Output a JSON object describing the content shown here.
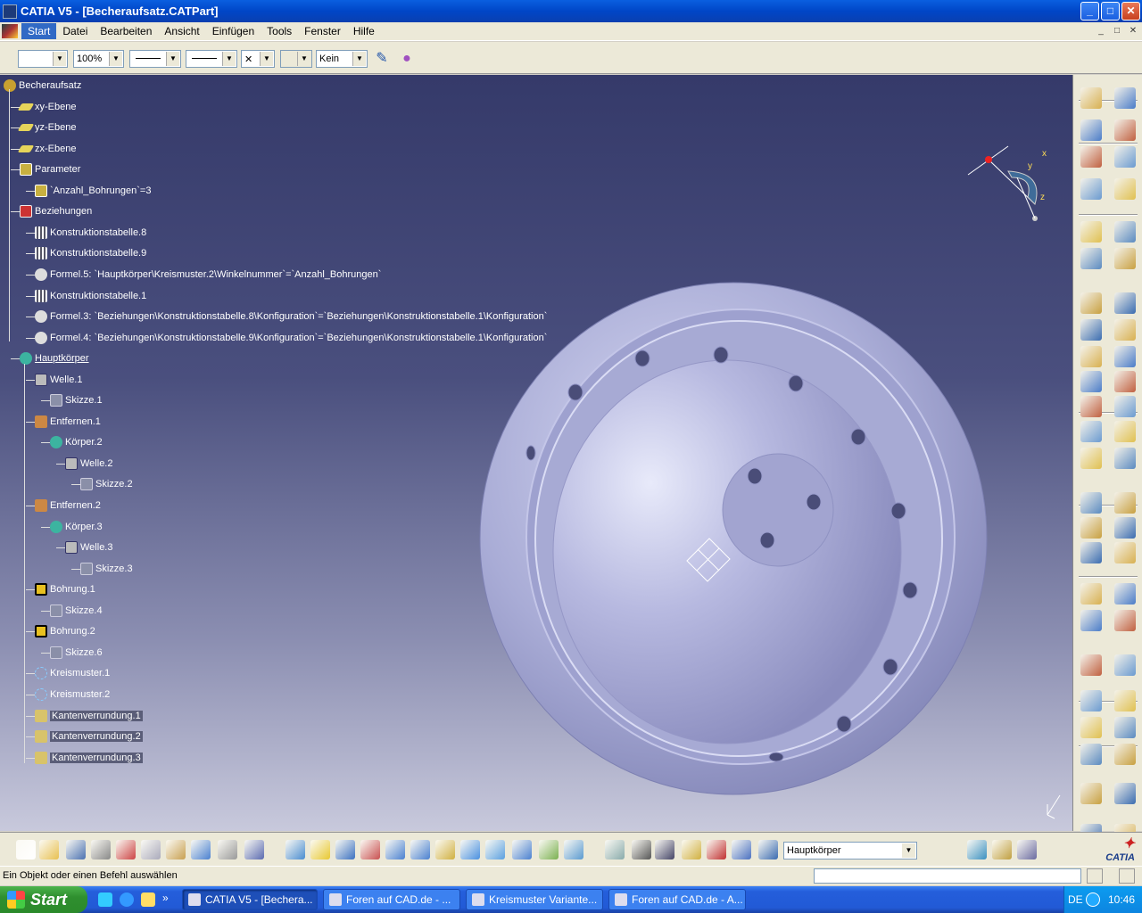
{
  "window": {
    "title": "CATIA V5 - [Becheraufsatz.CATPart]",
    "min_glyph": "_",
    "max_glyph": "□",
    "close_glyph": "✕"
  },
  "menu": {
    "items": [
      "Start",
      "Datei",
      "Bearbeiten",
      "Ansicht",
      "Einfügen",
      "Tools",
      "Fenster",
      "Hilfe"
    ]
  },
  "property_toolbar": {
    "color_value": "",
    "transparency_value": "100%",
    "linetype_value": "",
    "linewidth_value": "",
    "point_value": "✕",
    "layer_value": "Kein"
  },
  "tree": {
    "nodes": [
      {
        "label": "Becheraufsatz",
        "icon": "root"
      },
      {
        "label": "xy-Ebene",
        "icon": "plane"
      },
      {
        "label": "yz-Ebene",
        "icon": "plane"
      },
      {
        "label": "zx-Ebene",
        "icon": "plane"
      },
      {
        "label": "Parameter",
        "icon": "params"
      },
      {
        "label": "`Anzahl_Bohrungen`=3",
        "icon": "params"
      },
      {
        "label": "Beziehungen",
        "icon": "rel"
      },
      {
        "label": "Konstruktionstabelle.8",
        "icon": "table"
      },
      {
        "label": "Konstruktionstabelle.9",
        "icon": "table"
      },
      {
        "label": "Formel.5: `Hauptkörper\\Kreismuster.2\\Winkelnummer`=`Anzahl_Bohrungen`",
        "icon": "formula"
      },
      {
        "label": "Konstruktionstabelle.1",
        "icon": "table"
      },
      {
        "label": "Formel.3: `Beziehungen\\Konstruktionstabelle.8\\Konfiguration`=`Beziehungen\\Konstruktionstabelle.1\\Konfiguration`",
        "icon": "formula"
      },
      {
        "label": "Formel.4: `Beziehungen\\Konstruktionstabelle.9\\Konfiguration`=`Beziehungen\\Konstruktionstabelle.1\\Konfiguration`",
        "icon": "formula"
      },
      {
        "label": "Hauptkörper",
        "icon": "body"
      },
      {
        "label": "Welle.1",
        "icon": "shaft"
      },
      {
        "label": "Skizze.1",
        "icon": "sketch"
      },
      {
        "label": "Entfernen.1",
        "icon": "pocket"
      },
      {
        "label": "Körper.2",
        "icon": "body"
      },
      {
        "label": "Welle.2",
        "icon": "shaft"
      },
      {
        "label": "Skizze.2",
        "icon": "sketch"
      },
      {
        "label": "Entfernen.2",
        "icon": "pocket"
      },
      {
        "label": "Körper.3",
        "icon": "body"
      },
      {
        "label": "Welle.3",
        "icon": "shaft"
      },
      {
        "label": "Skizze.3",
        "icon": "sketch"
      },
      {
        "label": "Bohrung.1",
        "icon": "hole"
      },
      {
        "label": "Skizze.4",
        "icon": "sketch"
      },
      {
        "label": "Bohrung.2",
        "icon": "hole"
      },
      {
        "label": "Skizze.6",
        "icon": "sketch"
      },
      {
        "label": "Kreismuster.1",
        "icon": "pattern"
      },
      {
        "label": "Kreismuster.2",
        "icon": "pattern"
      },
      {
        "label": "Kantenverrundung.1",
        "icon": "fillet"
      },
      {
        "label": "Kantenverrundung.2",
        "icon": "fillet"
      },
      {
        "label": "Kantenverrundung.3",
        "icon": "fillet"
      }
    ]
  },
  "compass": {
    "x_label": "x",
    "y_label": "y",
    "z_label": "z"
  },
  "bottom_toolbar": {
    "body_select_value": "Hauptkörper",
    "scale_glyph": "10:1",
    "more_glyph": "»"
  },
  "status": {
    "text": "Ein Objekt oder einen Befehl auswählen"
  },
  "taskbar": {
    "start_label": "Start",
    "tasks": [
      "CATIA V5 - [Bechera...",
      "Foren auf CAD.de - ...",
      "Kreismuster Variante...",
      "Foren auf CAD.de - A..."
    ],
    "more_glyph": "»",
    "lang": "DE",
    "clock": "10:46"
  },
  "colors": {
    "viewport_top": "#353a6a",
    "viewport_bottom": "#c8c9dc",
    "part": "#b4b6dc",
    "titlebar": "#0046c7"
  }
}
